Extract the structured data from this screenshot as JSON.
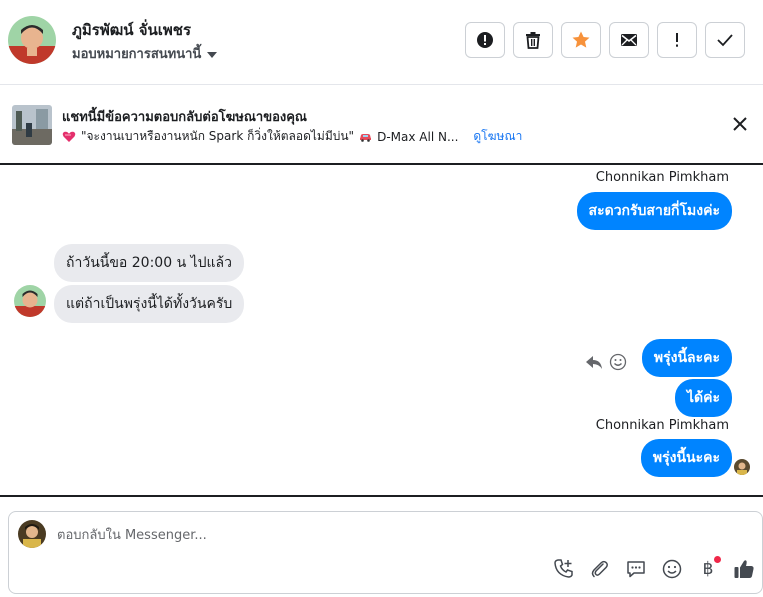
{
  "header": {
    "contact_name": "ภูมิรพัฒน์ จั่นเพชร",
    "assign_label": "มอบหมายการสนทนานี้",
    "actions": [
      {
        "name": "report-spam-button",
        "icon": "alert-circle-icon"
      },
      {
        "name": "delete-button",
        "icon": "trash-icon"
      },
      {
        "name": "star-button",
        "icon": "star-icon"
      },
      {
        "name": "mark-unread-button",
        "icon": "envelope-icon"
      },
      {
        "name": "follow-up-button",
        "icon": "exclamation-icon"
      },
      {
        "name": "mark-done-button",
        "icon": "check-icon"
      }
    ],
    "star_color": "#f7923b"
  },
  "ad_banner": {
    "title": "แชทนี้มีข้อความตอบกลับต่อโฆษณาของคุณ",
    "ad_text": "\"จะงานเบาหรืองานหนัก Spark ก็วิ่งให้ตลอดไม่มีบ่น\"",
    "ad_suffix": "D-Max All N...",
    "view_ad_link": "ดูโฆษณา"
  },
  "messages": [
    {
      "direction": "out",
      "sender": "Chonnikan Pimkham",
      "text": "สะดวกรับสายกี่โมงค่ะ"
    },
    {
      "direction": "in",
      "text": "ถ้าวันนี้ขอ 20:00 น ไปแล้ว"
    },
    {
      "direction": "in",
      "text": "แต่ถ้าเป็นพรุ่งนี้ได้ทั้งวันครับ"
    },
    {
      "direction": "out",
      "text": "พรุ่งนี้ละคะ"
    },
    {
      "direction": "out",
      "text": "ได้ค่ะ"
    },
    {
      "direction": "out",
      "sender": "Chonnikan Pimkham",
      "text": "พรุ่งนี้นะคะ"
    }
  ],
  "composer": {
    "placeholder": "ตอบกลับใน Messenger...",
    "tools": [
      "add-call-icon",
      "paperclip-icon",
      "saved-replies-icon",
      "emoji-icon",
      "payment-icon",
      "thumbs-up-icon"
    ],
    "baht_symbol": "฿"
  },
  "colors": {
    "accent": "#0084ff",
    "incoming_bubble": "#e9eaee",
    "link": "#1876f2",
    "notification_dot": "#f02849"
  }
}
